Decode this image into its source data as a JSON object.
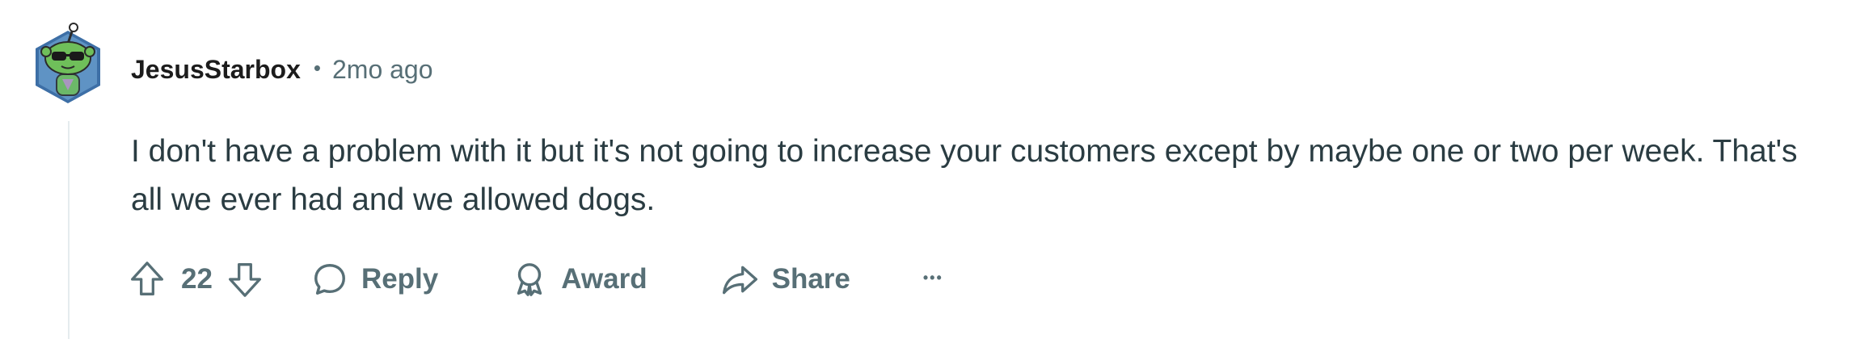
{
  "comment": {
    "author": "JesusStarbox",
    "separator": "•",
    "timestamp": "2mo ago",
    "body": "I don't have a problem with it but it's not going to increase your customers except by maybe one or two per week. That's all we ever had and we allowed dogs.",
    "score": "22"
  },
  "actions": {
    "reply_label": "Reply",
    "award_label": "Award",
    "share_label": "Share",
    "more_label": "•••"
  },
  "icons": {
    "avatar": "snoo-avatar-sunglasses",
    "upvote": "arrow-up-outline-icon",
    "downvote": "arrow-down-outline-icon",
    "reply": "speech-bubble-icon",
    "award": "award-ribbon-icon",
    "share": "share-arrow-icon",
    "more": "ellipsis-icon"
  },
  "colors": {
    "text_primary": "#1c1c1c",
    "text_secondary": "#576f76",
    "body_text": "#2a3c42",
    "thread_line": "#e5ebee",
    "avatar_bg": "#3d6fa6",
    "avatar_snoo": "#6fbf5a"
  }
}
